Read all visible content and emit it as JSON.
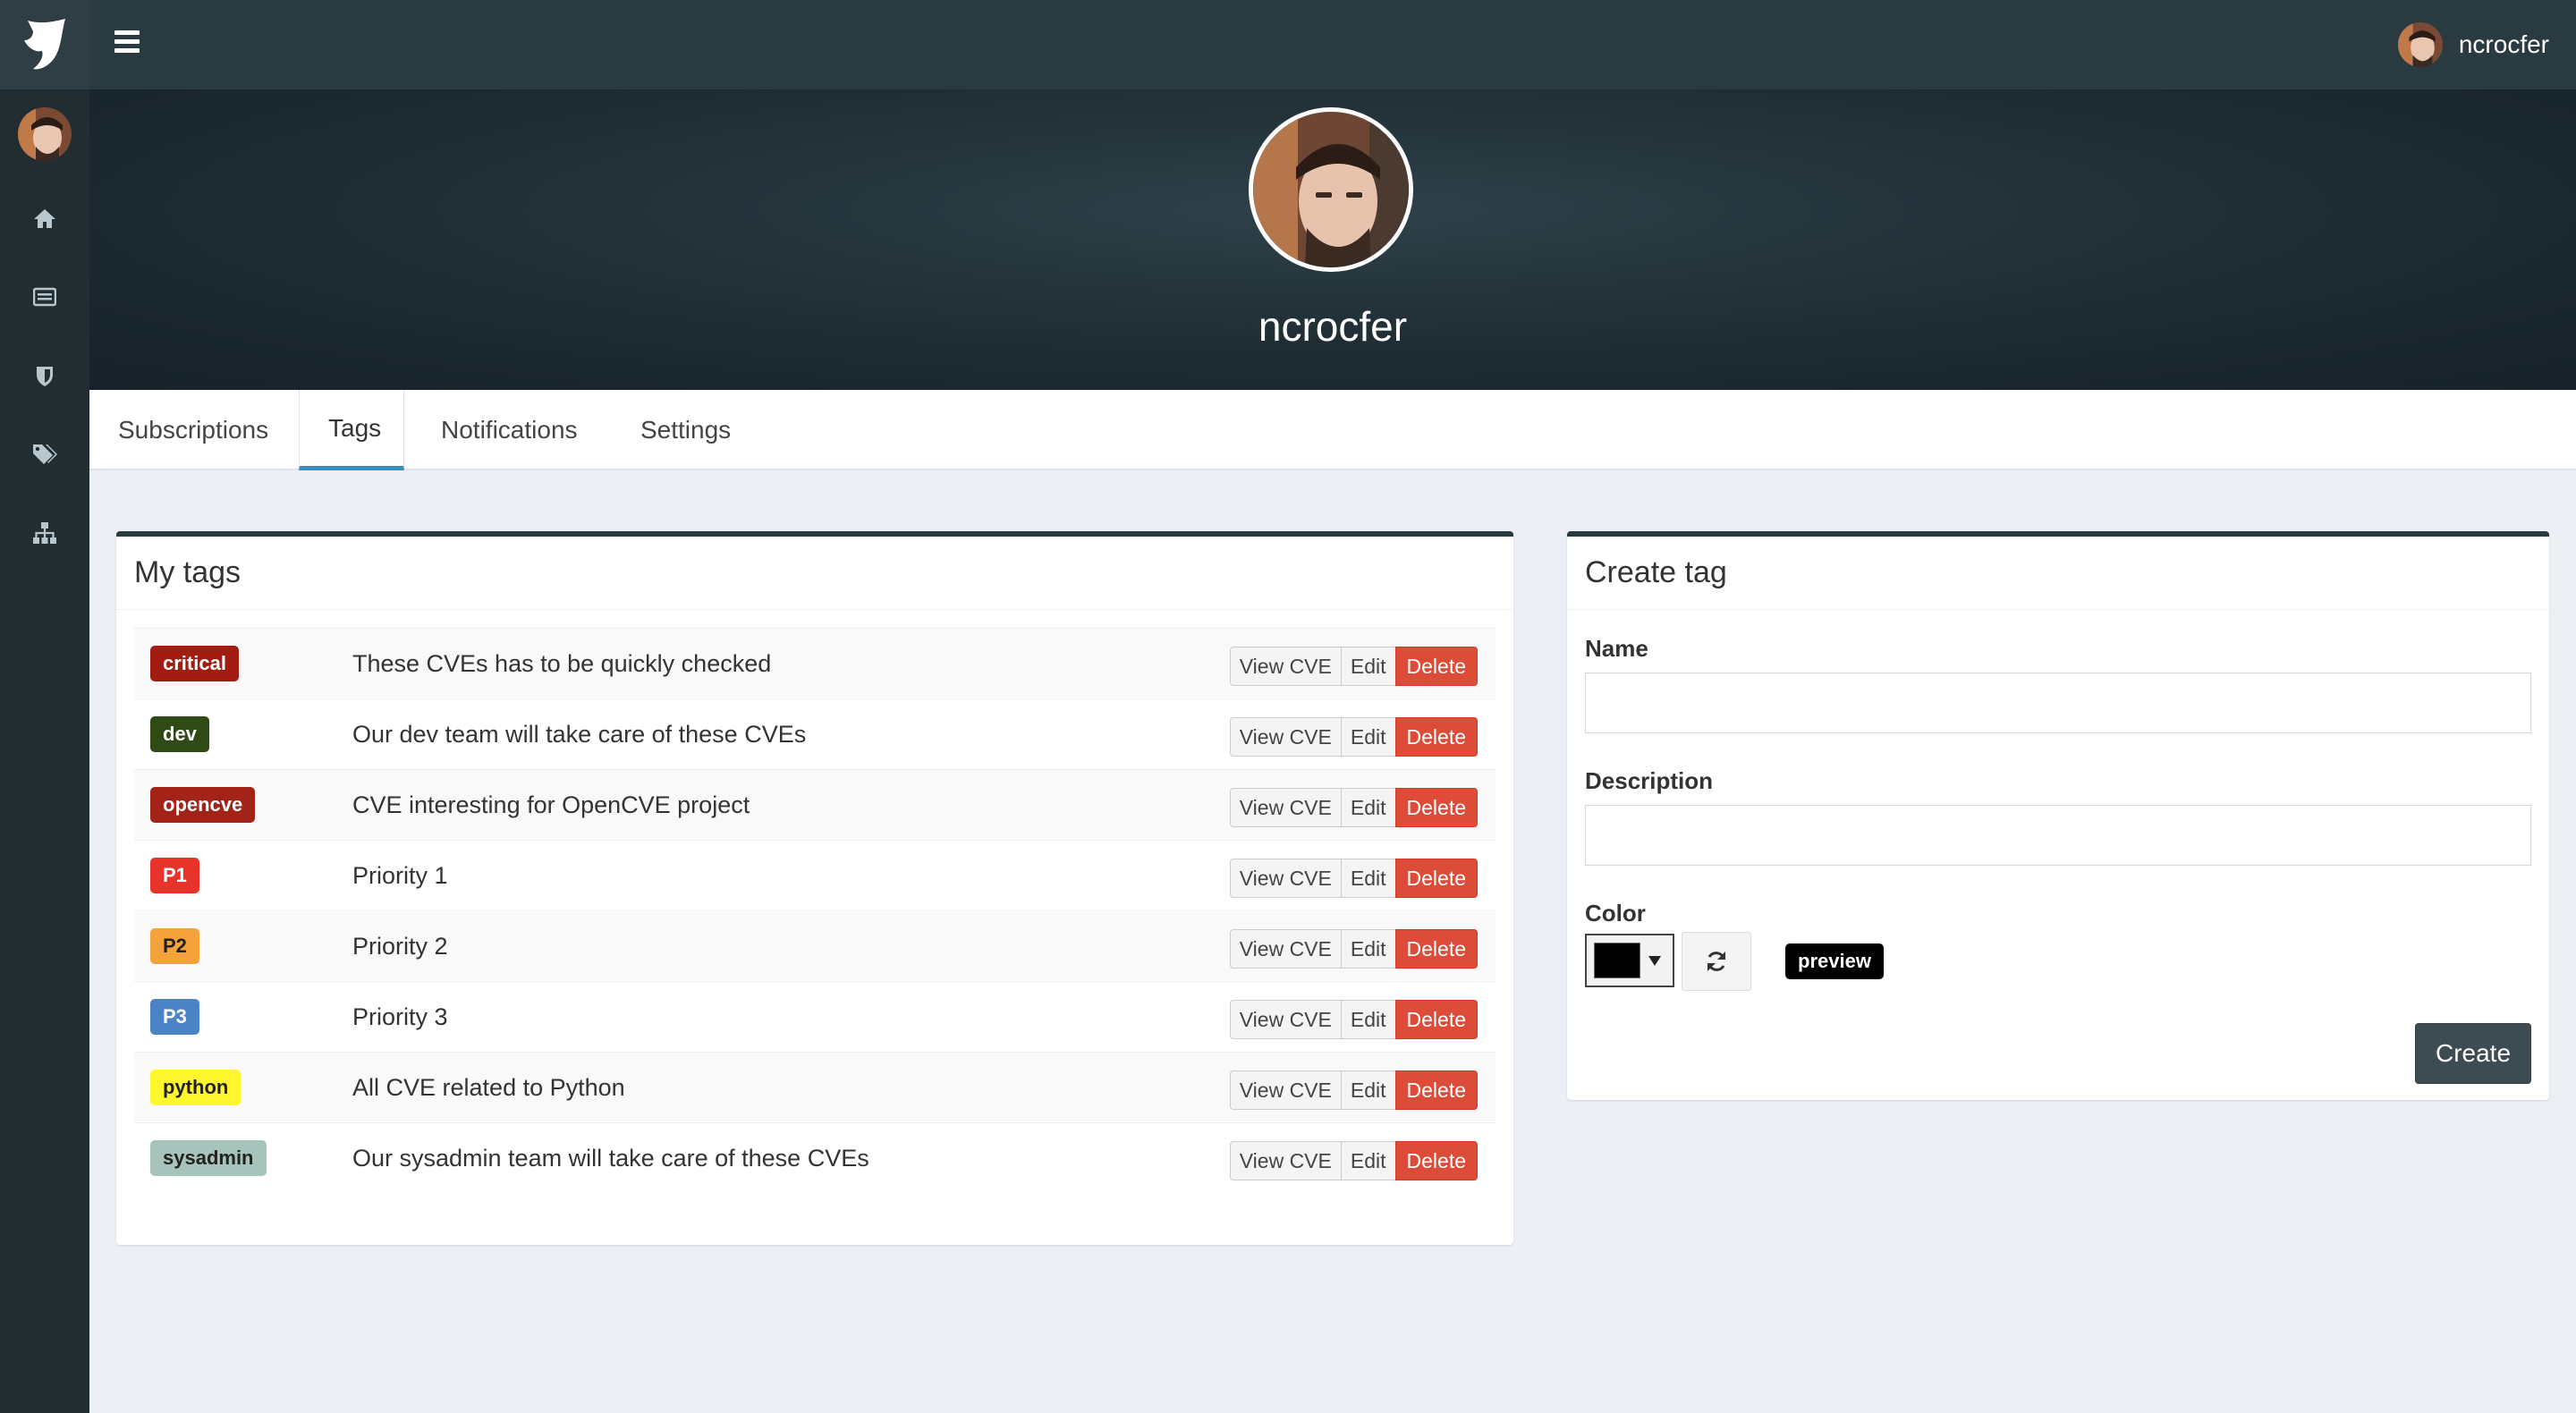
{
  "user": {
    "username": "ncrocfer"
  },
  "sidebar": {
    "items": [
      {
        "icon": "home-icon"
      },
      {
        "icon": "list-icon"
      },
      {
        "icon": "shield-icon"
      },
      {
        "icon": "tags-icon"
      },
      {
        "icon": "sitemap-icon"
      }
    ]
  },
  "tabs": [
    {
      "label": "Subscriptions"
    },
    {
      "label": "Tags",
      "active": true
    },
    {
      "label": "Notifications"
    },
    {
      "label": "Settings"
    }
  ],
  "my_tags": {
    "title": "My tags",
    "buttons": {
      "view": "View CVE",
      "edit": "Edit",
      "delete": "Delete"
    },
    "tags": [
      {
        "name": "critical",
        "description": "These CVEs has to be quickly checked",
        "bg": "#a31c12",
        "fg": "#ffffff"
      },
      {
        "name": "dev",
        "description": "Our dev team will take care of these CVEs",
        "bg": "#2f4a14",
        "fg": "#ffffff"
      },
      {
        "name": "opencve",
        "description": "CVE interesting for OpenCVE project",
        "bg": "#a42318",
        "fg": "#ffffff"
      },
      {
        "name": "P1",
        "description": "Priority 1",
        "bg": "#e8332a",
        "fg": "#ffffff"
      },
      {
        "name": "P2",
        "description": "Priority 2",
        "bg": "#f4a23c",
        "fg": "#222222"
      },
      {
        "name": "P3",
        "description": "Priority 3",
        "bg": "#4a84c6",
        "fg": "#ffffff"
      },
      {
        "name": "python",
        "description": "All CVE related to Python",
        "bg": "#fff72e",
        "fg": "#222222"
      },
      {
        "name": "sysadmin",
        "description": "Our sysadmin team will take care of these CVEs",
        "bg": "#a7c4bc",
        "fg": "#222222"
      }
    ]
  },
  "create_tag": {
    "title": "Create tag",
    "name_label": "Name",
    "name_value": "",
    "description_label": "Description",
    "description_value": "",
    "color_label": "Color",
    "color_value": "#000000",
    "preview_label": "preview",
    "create_label": "Create"
  },
  "colors": {
    "sidebar": "#222d32",
    "topbar": "#2a3a41",
    "danger": "#dd4b39",
    "accent": "#3c8dbc"
  }
}
